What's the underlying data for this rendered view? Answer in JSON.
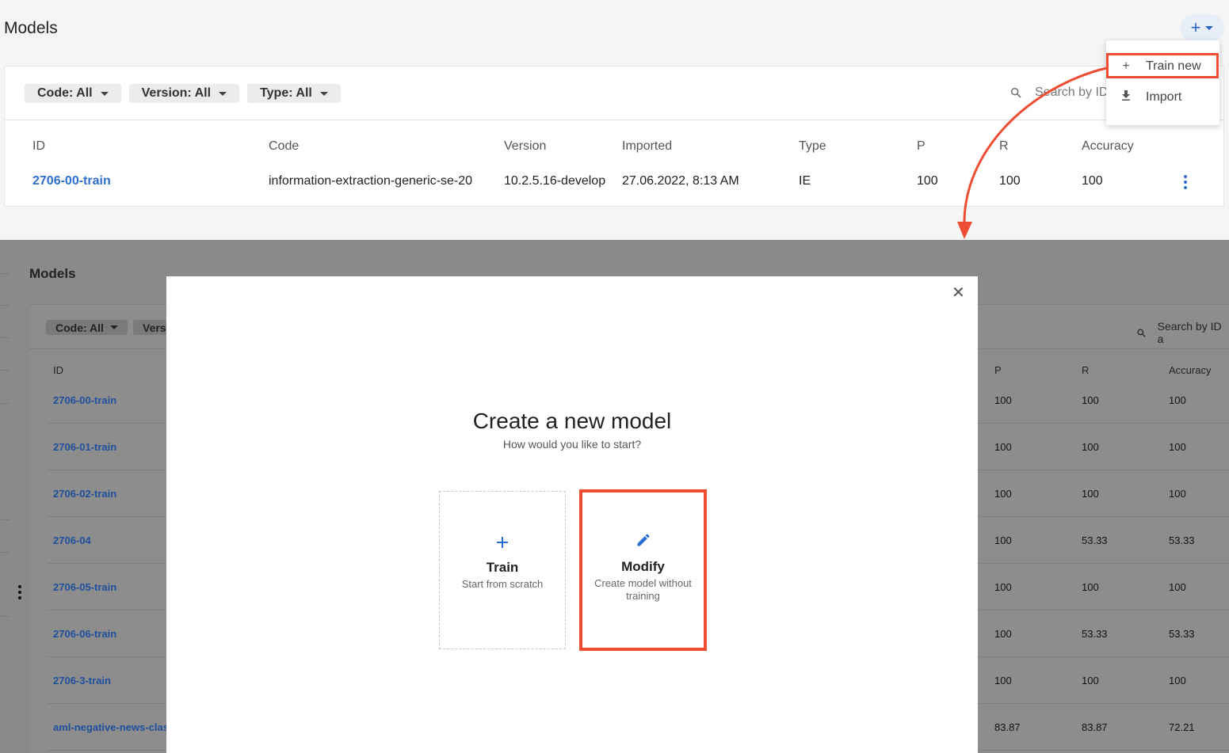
{
  "top": {
    "title": "Models",
    "filters": [
      "Code: All",
      "Version: All",
      "Type: All"
    ],
    "search_placeholder": "Search by ID",
    "columns": [
      "ID",
      "Code",
      "Version",
      "Imported",
      "Type",
      "P",
      "R",
      "Accuracy"
    ],
    "row": {
      "id": "2706-00-train",
      "code": "information-extraction-generic-se-20",
      "version": "10.2.5.16-develop",
      "imported": "27.06.2022, 8:13 AM",
      "type": "IE",
      "p": "100",
      "r": "100",
      "accuracy": "100"
    },
    "dropdown": {
      "train_new": "Train new",
      "import": "Import"
    }
  },
  "bottom": {
    "title": "Models",
    "filters": [
      "Code: All",
      "Vers"
    ],
    "search_placeholder": "Search by ID a",
    "columns": {
      "id": "ID",
      "p": "P",
      "r": "R",
      "accuracy": "Accuracy"
    },
    "rows": [
      {
        "id": "2706-00-train",
        "p": "100",
        "r": "100",
        "accuracy": "100"
      },
      {
        "id": "2706-01-train",
        "p": "100",
        "r": "100",
        "accuracy": "100"
      },
      {
        "id": "2706-02-train",
        "p": "100",
        "r": "100",
        "accuracy": "100"
      },
      {
        "id": "2706-04",
        "p": "100",
        "r": "53.33",
        "accuracy": "53.33"
      },
      {
        "id": "2706-05-train",
        "p": "100",
        "r": "100",
        "accuracy": "100"
      },
      {
        "id": "2706-06-train",
        "p": "100",
        "r": "53.33",
        "accuracy": "53.33"
      },
      {
        "id": "2706-3-train",
        "p": "100",
        "r": "100",
        "accuracy": "100"
      },
      {
        "id": "aml-negative-news-class",
        "p": "83.87",
        "r": "83.87",
        "accuracy": "72.21"
      }
    ]
  },
  "modal": {
    "title": "Create a new model",
    "subtitle": "How would you like to start?",
    "options": [
      {
        "title": "Train",
        "description": "Start from scratch",
        "icon": "plus-icon"
      },
      {
        "title": "Modify",
        "description": "Create model without training",
        "icon": "pencil-icon"
      }
    ]
  },
  "colors": {
    "accent": "#2a6fd6",
    "link": "#2f6fcf",
    "highlight": "#ee4d33",
    "overlay": "#8a8a8a"
  }
}
